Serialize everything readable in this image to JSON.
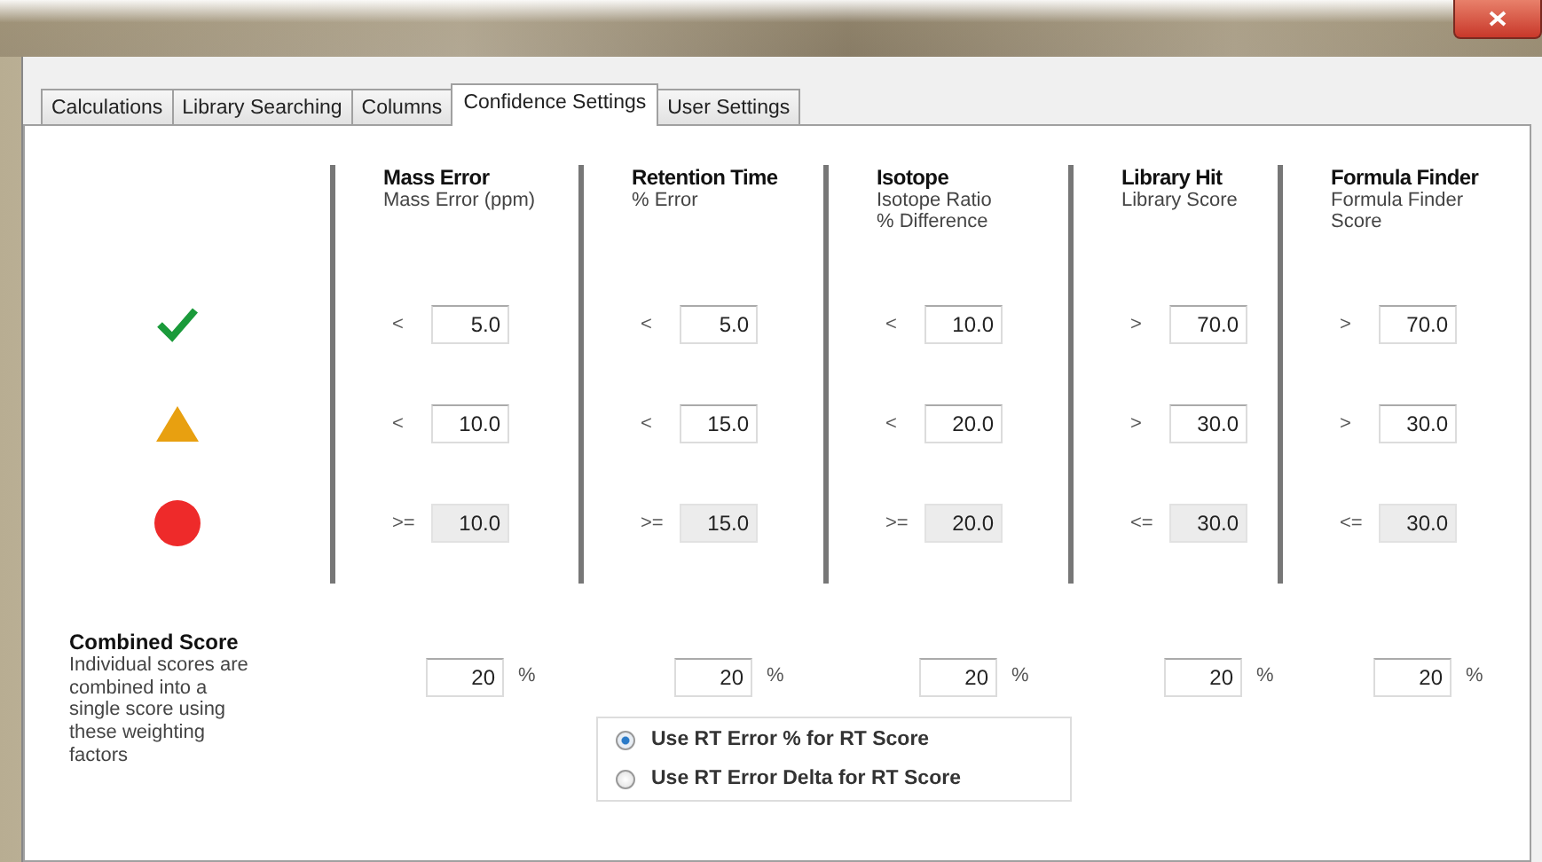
{
  "tabs": [
    {
      "label": "Calculations",
      "selected": false
    },
    {
      "label": "Library Searching",
      "selected": false
    },
    {
      "label": "Columns",
      "selected": false
    },
    {
      "label": "Confidence Settings",
      "selected": true
    },
    {
      "label": "User Settings",
      "selected": false
    }
  ],
  "levels": [
    {
      "kind": "check",
      "color": "#1a9a3a"
    },
    {
      "kind": "triangle",
      "color": "#e8a010"
    },
    {
      "kind": "circle",
      "color": "#ee2a2a"
    }
  ],
  "criteria": [
    {
      "title": "Mass Error",
      "subtitle": "Mass Error (ppm)",
      "thresholds": [
        {
          "op": "<",
          "value": "5.0",
          "disabled": false
        },
        {
          "op": "<",
          "value": "10.0",
          "disabled": false
        },
        {
          "op": ">=",
          "value": "10.0",
          "disabled": true
        }
      ],
      "weight": "20",
      "unit": "%"
    },
    {
      "title": "Retention Time",
      "subtitle": "% Error",
      "thresholds": [
        {
          "op": "<",
          "value": "5.0",
          "disabled": false
        },
        {
          "op": "<",
          "value": "15.0",
          "disabled": false
        },
        {
          "op": ">=",
          "value": "15.0",
          "disabled": true
        }
      ],
      "weight": "20",
      "unit": "%"
    },
    {
      "title": "Isotope",
      "subtitle": "Isotope Ratio\n% Difference",
      "thresholds": [
        {
          "op": "<",
          "value": "10.0",
          "disabled": false
        },
        {
          "op": "<",
          "value": "20.0",
          "disabled": false
        },
        {
          "op": ">=",
          "value": "20.0",
          "disabled": true
        }
      ],
      "weight": "20",
      "unit": "%"
    },
    {
      "title": "Library Hit",
      "subtitle": "Library Score",
      "thresholds": [
        {
          "op": ">",
          "value": "70.0",
          "disabled": false
        },
        {
          "op": ">",
          "value": "30.0",
          "disabled": false
        },
        {
          "op": "<=",
          "value": "30.0",
          "disabled": true
        }
      ],
      "weight": "20",
      "unit": "%"
    },
    {
      "title": "Formula Finder",
      "subtitle": "Formula Finder\nScore",
      "thresholds": [
        {
          "op": ">",
          "value": "70.0",
          "disabled": false
        },
        {
          "op": ">",
          "value": "30.0",
          "disabled": false
        },
        {
          "op": "<=",
          "value": "30.0",
          "disabled": true
        }
      ],
      "weight": "20",
      "unit": "%"
    }
  ],
  "combined": {
    "title": "Combined Score",
    "description": "Individual scores are combined into a single score using these weighting factors"
  },
  "rt_options": [
    {
      "label": "Use RT Error % for RT Score",
      "selected": true
    },
    {
      "label": "Use RT Error Delta  for RT Score",
      "selected": false
    }
  ]
}
